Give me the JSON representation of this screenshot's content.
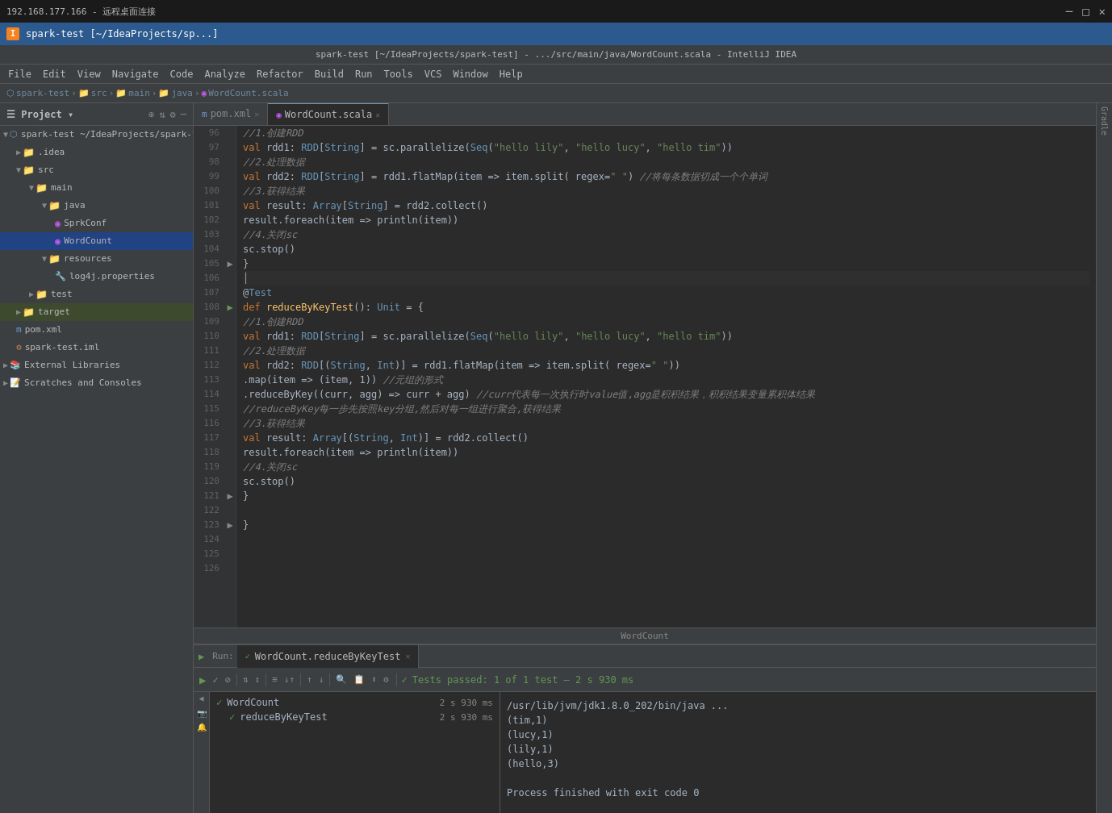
{
  "titlebar": {
    "remote": "192.168.177.166 - 远程桌面连接",
    "app_title": "spark-test [~/IdeaProjects/sp...]",
    "window_title": "spark-test [~/IdeaProjects/spark-test] - .../src/main/java/WordCount.scala - IntelliJ IDEA"
  },
  "menubar": {
    "items": [
      "File",
      "Edit",
      "View",
      "Navigate",
      "Code",
      "Analyze",
      "Refactor",
      "Build",
      "Run",
      "Tools",
      "VCS",
      "Window",
      "Help"
    ]
  },
  "breadcrumb": {
    "items": [
      "spark-test",
      "src",
      "main",
      "java",
      "WordCount.scala"
    ]
  },
  "sidebar": {
    "header": "Project",
    "tree": [
      {
        "label": "spark-test ~/IdeaProjects/spark-test",
        "level": 0,
        "type": "module",
        "expanded": true
      },
      {
        "label": ".idea",
        "level": 1,
        "type": "folder",
        "expanded": false
      },
      {
        "label": "src",
        "level": 1,
        "type": "folder",
        "expanded": true
      },
      {
        "label": "main",
        "level": 2,
        "type": "folder",
        "expanded": true
      },
      {
        "label": "java",
        "level": 3,
        "type": "folder",
        "expanded": true
      },
      {
        "label": "SprkConf",
        "level": 4,
        "type": "scala"
      },
      {
        "label": "WordCount",
        "level": 4,
        "type": "scala",
        "selected": true
      },
      {
        "label": "resources",
        "level": 3,
        "type": "folder",
        "expanded": true
      },
      {
        "label": "log4j.properties",
        "level": 4,
        "type": "prop"
      },
      {
        "label": "test",
        "level": 2,
        "type": "folder",
        "expanded": false
      },
      {
        "label": "target",
        "level": 1,
        "type": "folder",
        "expanded": false,
        "highlighted": true
      },
      {
        "label": "pom.xml",
        "level": 1,
        "type": "xml"
      },
      {
        "label": "spark-test.iml",
        "level": 1,
        "type": "iml"
      },
      {
        "label": "External Libraries",
        "level": 0,
        "type": "external"
      },
      {
        "label": "Scratches and Consoles",
        "level": 0,
        "type": "scratch"
      }
    ]
  },
  "tabs": [
    {
      "label": "pom.xml",
      "type": "xml",
      "active": false
    },
    {
      "label": "WordCount.scala",
      "type": "scala",
      "active": true
    }
  ],
  "code": {
    "lines": [
      {
        "n": 96,
        "fold": "",
        "content": "    //<kw>1.</kw><chinese-comment>创建RDD</chinese-comment>"
      },
      {
        "n": 97,
        "fold": "",
        "content": "    <kw>val</kw> rdd1: <type>RDD</type>[<type>String</type>] = sc.parallelize(<type>Seq</type>(<str>\"hello lily\"</str>, <str>\"hello lucy\"</str>, <str>\"hello tim\"</str>))"
      },
      {
        "n": 98,
        "fold": "",
        "content": "    //<chinese-comment>2.处理数据</chinese-comment>"
      },
      {
        "n": 99,
        "fold": "",
        "content": "    <kw>val</kw> rdd2: <type>RDD</type>[<type>String</type>] = rdd1.flatMap(<kw>item</kw> => item.split( regex=<str>\" \"</str>)) <comment>//将每条数据切成一个个单词</comment>"
      },
      {
        "n": 100,
        "fold": "",
        "content": "    //<chinese-comment>3.获得结果</chinese-comment>"
      },
      {
        "n": 101,
        "fold": "",
        "content": "    <kw>val</kw> result: <type>Array</type>[<type>String</type>] = rdd2.collect()"
      },
      {
        "n": 102,
        "fold": "",
        "content": "    result.foreach(<kw>item</kw> => println(<kw>item</kw>))"
      },
      {
        "n": 103,
        "fold": "",
        "content": "    //<chinese-comment>4.关闭sc</chinese-comment>"
      },
      {
        "n": 104,
        "fold": "",
        "content": "    sc.stop()"
      },
      {
        "n": 105,
        "fold": "▶",
        "content": "  }"
      },
      {
        "n": 106,
        "fold": "",
        "content": ""
      },
      {
        "n": 107,
        "fold": "",
        "content": "  @<type>Test</type>"
      },
      {
        "n": 108,
        "fold": "▶",
        "content": "  <kw>def</kw> <fn>reduceByKeyTest</fn>(): <type>Unit</type> = {",
        "runnable": true
      },
      {
        "n": 109,
        "fold": "",
        "content": "    //<chinese-comment>1.创建RDD</chinese-comment>"
      },
      {
        "n": 110,
        "fold": "",
        "content": "    <kw>val</kw> rdd1: <type>RDD</type>[<type>String</type>] = sc.parallelize(<type>Seq</type>(<str>\"hello lily\"</str>, <str>\"hello lucy\"</str>, <str>\"hello tim\"</str>))"
      },
      {
        "n": 111,
        "fold": "",
        "content": "    //<chinese-comment>2.处理数据</chinese-comment>"
      },
      {
        "n": 112,
        "fold": "",
        "content": "    <kw>val</kw> rdd2: <type>RDD</type>[(<type>String</type>, <type>Int</type>)] = rdd1.flatMap(<kw>item</kw> => item.split( regex=<str>\" \"</str>))"
      },
      {
        "n": 113,
        "fold": "",
        "content": "      .map(<kw>item</kw> => (<kw>item</kw>, 1)) <comment>//元组的形式</comment>"
      },
      {
        "n": 114,
        "fold": "",
        "content": "      .reduceByKey((curr, agg) => curr + agg) <comment>//curr代表每一次执行时value值,agg是积积结果，积积结果变量累积体结果</comment>"
      },
      {
        "n": 115,
        "fold": "",
        "content": "    <comment>//reduceByKey每一步先按照key分组,然后对每一组进行聚合,获得结果</comment>"
      },
      {
        "n": 116,
        "fold": "",
        "content": "    //<chinese-comment>3.获得结果</chinese-comment>"
      },
      {
        "n": 117,
        "fold": "",
        "content": "    <kw>val</kw> result: <type>Array</type>[(<type>String</type>, <type>Int</type>)] = rdd2.collect()"
      },
      {
        "n": 118,
        "fold": "",
        "content": "    result.foreach(<kw>item</kw> => println(<kw>item</kw>))"
      },
      {
        "n": 119,
        "fold": "",
        "content": "    //<chinese-comment>4.关闭sc</chinese-comment>"
      },
      {
        "n": 120,
        "fold": "",
        "content": "    sc.stop()"
      },
      {
        "n": 121,
        "fold": "▶",
        "content": "  }"
      },
      {
        "n": 122,
        "fold": "",
        "content": ""
      },
      {
        "n": 123,
        "fold": "▶",
        "content": "}"
      },
      {
        "n": 124,
        "fold": "",
        "content": ""
      },
      {
        "n": 125,
        "fold": "",
        "content": ""
      },
      {
        "n": 126,
        "fold": "",
        "content": ""
      }
    ],
    "footer": "WordCount"
  },
  "run_panel": {
    "tab_label": "WordCount.reduceByKeyTest",
    "toolbar_buttons": [
      "▶",
      "✓",
      "⊘",
      "⇅↕",
      "↑↓",
      "≡",
      "↓↑",
      "↑",
      "↓",
      "🔍",
      "📋",
      "⬆",
      "⚙"
    ],
    "test_status": "Tests passed: 1 of 1 test – 2 s 930 ms",
    "tree": [
      {
        "label": "WordCount",
        "time": "2 s 930 ms",
        "level": 0,
        "status": "pass",
        "expanded": true
      },
      {
        "label": "reduceByKeyTest",
        "time": "2 s 930 ms",
        "level": 1,
        "status": "pass"
      }
    ],
    "output_lines": [
      "/usr/lib/jvm/jdk1.8.0_202/bin/java ...",
      "(tim,1)",
      "(lucy,1)",
      "(lily,1)",
      "(hello,3)",
      "",
      "Process finished with exit code 0"
    ]
  },
  "colors": {
    "accent": "#6897bb",
    "background": "#2b2b2b",
    "sidebar_bg": "#3c3f41",
    "keyword": "#cc7832",
    "string": "#6a8759",
    "comment": "#808080",
    "type": "#6897bb",
    "function": "#ffc66d",
    "pass_color": "#629755"
  }
}
